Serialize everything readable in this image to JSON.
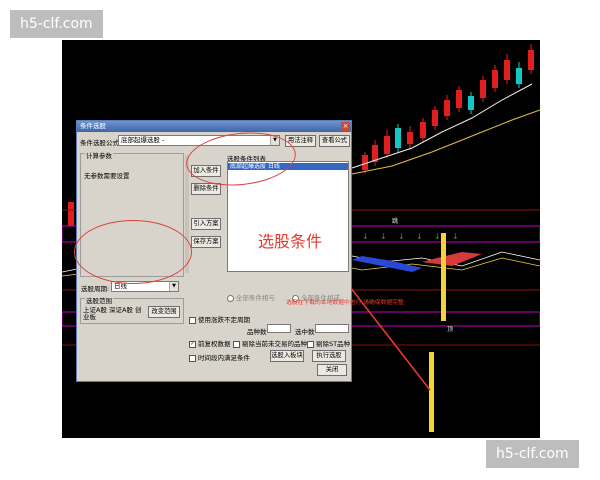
{
  "watermarks": {
    "top": "h5-clf.com",
    "bottom": "h5-clf.com"
  },
  "dialog": {
    "title": "条件选股",
    "close_glyph": "×",
    "formula_label": "条件选股公式",
    "formula_value": "底部起爆选股 -",
    "usage_button": "用法注释",
    "view_formula_button": "查看公式",
    "params_group_label": "计算参数",
    "params_text": "无参数需要设置",
    "add_condition_button": "加入条件",
    "delete_condition_button": "删除条件",
    "import_plan_button": "引入方案",
    "save_plan_button": "保存方案",
    "condition_list_label": "选股条件列表",
    "condition_list_items": [
      "底部起爆选股  日线"
    ],
    "period_label": "选股周期:",
    "period_value": "日线",
    "range_group_label": "选股范围",
    "range_text": "上证A股 深证A股 创业板",
    "change_range_button": "改变范围",
    "radio_all_and": "全部条件相与",
    "radio_all_or": "全部条件相或",
    "check_use_period": "使用涨跌不定周期",
    "count_label": "品种数",
    "selected_label": "选中数",
    "check_pre_adjust": "前复权数据",
    "check_exclude_untraded": "剔除当前未交易的品种",
    "check_exclude_st": "剔除ST品种",
    "check_time_range": "时间段内满足条件",
    "add_to_block_button": "选股入板块",
    "execute_button": "执行选股",
    "close_button": "关闭"
  },
  "annotation": {
    "title": "选股条件",
    "hint": "选股在下载的本地数据中进行,请确保数据完整"
  },
  "chart_strip": {
    "buy_label": "跳",
    "lower_label": "顶"
  },
  "colors": {
    "up": "#e02020",
    "down": "#13c7c7",
    "highlight": "#f2d43a",
    "cyan": "#00d2ff",
    "magenta": "#c000c0",
    "green": "#18a818"
  }
}
